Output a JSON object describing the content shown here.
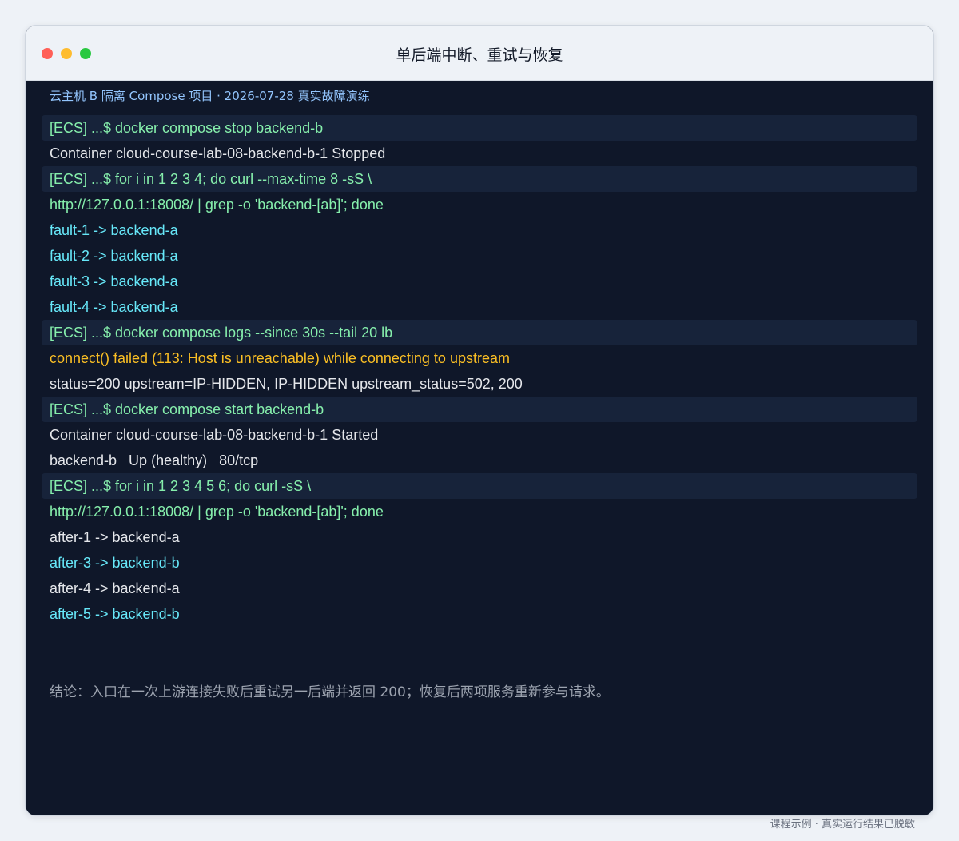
{
  "window": {
    "title": "单后端中断、重试与恢复",
    "controls": {
      "close_color": "#ff5f57",
      "minimize_color": "#febc2e",
      "zoom_color": "#28c840"
    }
  },
  "terminal": {
    "subtitle": "云主机 B 隔离 Compose 项目 · 2026-07-28 真实故障演练",
    "lines": [
      {
        "kind": "command",
        "color": "green",
        "text": "[ECS] ...$ docker compose stop backend-b"
      },
      {
        "kind": "output",
        "color": "white",
        "text": "Container cloud-course-lab-08-backend-b-1 Stopped"
      },
      {
        "kind": "command",
        "color": "green",
        "text": "[ECS] ...$ for i in 1 2 3 4; do curl --max-time 8 -sS \\"
      },
      {
        "kind": "output",
        "color": "green",
        "text": "http://127.0.0.1:18008/ | grep -o 'backend-[ab]'; done"
      },
      {
        "kind": "output",
        "color": "cyan",
        "text": "fault-1 -> backend-a"
      },
      {
        "kind": "output",
        "color": "cyan",
        "text": "fault-2 -> backend-a"
      },
      {
        "kind": "output",
        "color": "cyan",
        "text": "fault-3 -> backend-a"
      },
      {
        "kind": "output",
        "color": "cyan",
        "text": "fault-4 -> backend-a"
      },
      {
        "kind": "command",
        "color": "green",
        "text": "[ECS] ...$ docker compose logs --since 30s --tail 20 lb"
      },
      {
        "kind": "output",
        "color": "orange",
        "text": "connect() failed (113: Host is unreachable) while connecting to upstream"
      },
      {
        "kind": "output",
        "color": "white",
        "text": "status=200 upstream=IP-HIDDEN, IP-HIDDEN upstream_status=502, 200"
      },
      {
        "kind": "command",
        "color": "green",
        "text": "[ECS] ...$ docker compose start backend-b"
      },
      {
        "kind": "output",
        "color": "white",
        "text": "Container cloud-course-lab-08-backend-b-1 Started"
      },
      {
        "kind": "output",
        "color": "white",
        "text": "backend-b   Up (healthy)   80/tcp"
      },
      {
        "kind": "command",
        "color": "green",
        "text": "[ECS] ...$ for i in 1 2 3 4 5 6; do curl -sS \\"
      },
      {
        "kind": "output",
        "color": "green",
        "text": "http://127.0.0.1:18008/ | grep -o 'backend-[ab]'; done"
      },
      {
        "kind": "output",
        "color": "white",
        "text": "after-1 -> backend-a"
      },
      {
        "kind": "output",
        "color": "cyan",
        "text": "after-3 -> backend-b"
      },
      {
        "kind": "output",
        "color": "white",
        "text": "after-4 -> backend-a"
      },
      {
        "kind": "output",
        "color": "cyan",
        "text": "after-5 -> backend-b"
      }
    ],
    "conclusion": "结论：入口在一次上游连接失败后重试另一后端并返回 200；恢复后两项服务重新参与请求。"
  },
  "footer": {
    "caption": "课程示例 · 真实运行结果已脱敏"
  }
}
